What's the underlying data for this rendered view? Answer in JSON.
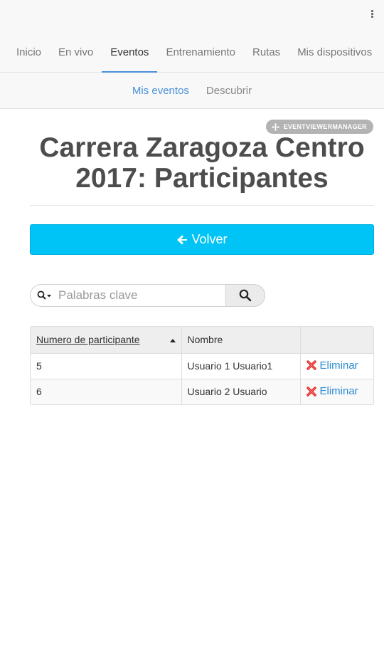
{
  "nav": {
    "tabs": [
      {
        "label": "Inicio"
      },
      {
        "label": "En vivo"
      },
      {
        "label": "Eventos"
      },
      {
        "label": "Entrenamiento"
      },
      {
        "label": "Rutas"
      },
      {
        "label": "Mis dispositivos"
      }
    ],
    "active_tab": "Eventos"
  },
  "subnav": {
    "items": [
      {
        "label": "Mis eventos"
      },
      {
        "label": "Descubrir"
      }
    ],
    "active": "Mis eventos"
  },
  "badge": {
    "label": "EVENTVIEWERMANAGER",
    "icon": "move-arrows-icon"
  },
  "page": {
    "title_line1": "Carrera Zaragoza Centro",
    "title_line2": "2017: Participantes"
  },
  "back_button": {
    "label": "Volver",
    "icon": "arrow-left-icon"
  },
  "search": {
    "placeholder": "Palabras clave",
    "value": "",
    "dropdown_icon": "search-dropdown-icon",
    "button_icon": "search-icon"
  },
  "table": {
    "columns": [
      {
        "label": "Numero de participante",
        "sorted": "ascending"
      },
      {
        "label": "Nombre"
      },
      {
        "label": ""
      }
    ],
    "rows": [
      {
        "number": "5",
        "name": "Usuario 1 Usuario1",
        "action": "Eliminar"
      },
      {
        "number": "6",
        "name": "Usuario 2 Usuario",
        "action": "Eliminar"
      }
    ]
  },
  "colors": {
    "accent": "#4a90d9",
    "primary_button": "#00c4f5",
    "delete_icon": "#e02424",
    "link": "#2a8bd1"
  }
}
